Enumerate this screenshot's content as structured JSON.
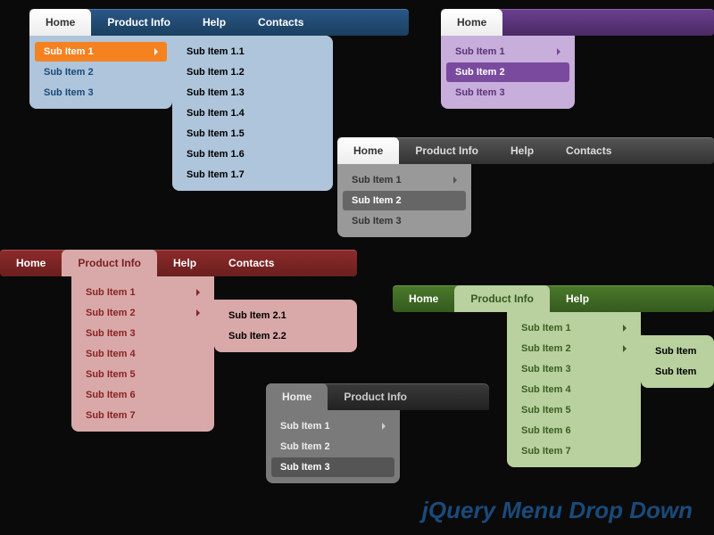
{
  "footer": "jQuery Menu Drop Down",
  "blue": {
    "tabs": [
      "Home",
      "Product Info",
      "Help",
      "Contacts"
    ],
    "activeIndex": 0,
    "dropdown": [
      "Sub Item 1",
      "Sub Item 2",
      "Sub Item 3"
    ],
    "hoverIndex": 0,
    "submenu": [
      "Sub Item 1.1",
      "Sub Item 1.2",
      "Sub Item 1.3",
      "Sub Item 1.4",
      "Sub Item 1.5",
      "Sub Item 1.6",
      "Sub Item 1.7"
    ]
  },
  "purple": {
    "tabs": [
      "Home"
    ],
    "activeIndex": 0,
    "dropdown": [
      "Sub Item 1",
      "Sub Item 2",
      "Sub Item 3"
    ],
    "hoverIndex": 1
  },
  "gray": {
    "tabs": [
      "Home",
      "Product Info",
      "Help",
      "Contacts"
    ],
    "activeIndex": 0,
    "dropdown": [
      "Sub Item 1",
      "Sub Item 2",
      "Sub Item 3"
    ],
    "hoverIndex": 1
  },
  "red": {
    "tabs": [
      "Home",
      "Product Info",
      "Help",
      "Contacts"
    ],
    "activeIndex": 1,
    "dropdown": [
      "Sub Item 1",
      "Sub Item 2",
      "Sub Item 3",
      "Sub Item 4",
      "Sub Item 5",
      "Sub Item 6",
      "Sub Item 7"
    ],
    "hoverIndex": 1,
    "submenu": [
      "Sub Item 2.1",
      "Sub Item 2.2"
    ],
    "subHoverIndex": 1
  },
  "green": {
    "tabs": [
      "Home",
      "Product Info",
      "Help"
    ],
    "activeIndex": 1,
    "dropdown": [
      "Sub Item 1",
      "Sub Item 2",
      "Sub Item 3",
      "Sub Item 4",
      "Sub Item 5",
      "Sub Item 6",
      "Sub Item 7"
    ],
    "submenu": [
      "Sub Item"
    ],
    "subHoverIndex": 0
  },
  "dark": {
    "tabs": [
      "Home",
      "Product Info"
    ],
    "activeIndex": 0,
    "dropdown": [
      "Sub Item 1",
      "Sub Item 2",
      "Sub Item 3"
    ],
    "hoverIndex": 2
  }
}
